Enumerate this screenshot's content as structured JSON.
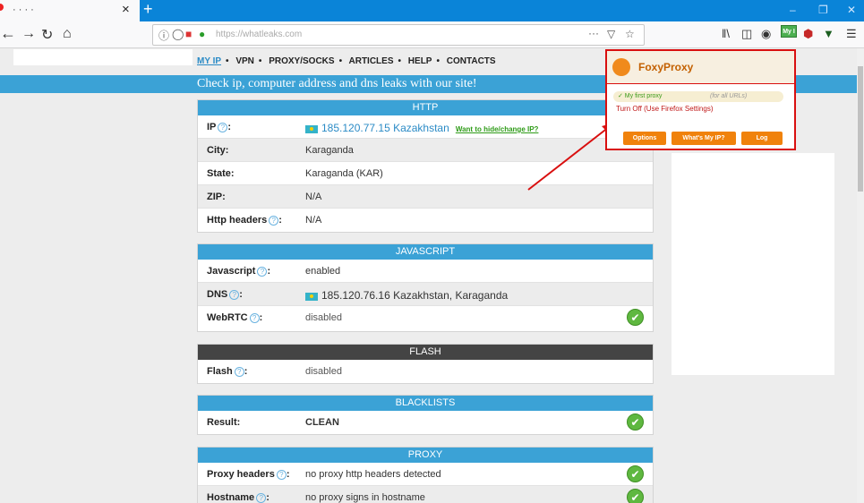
{
  "browser": {
    "tab_title": "· · · ·",
    "tab_close": "×",
    "newtab": "+",
    "url": "https://whatleaks.com",
    "page_actions": "···",
    "myip_badge": "My I"
  },
  "topnav": [
    "MY IP",
    "VPN",
    "PROXY/SOCKS",
    "ARTICLES",
    "HELP",
    "CONTACTS"
  ],
  "banner": "Check ip, computer address and dns leaks with our site!",
  "sections": {
    "http": {
      "title": "HTTP",
      "ip_label": "IP",
      "ip_value": "185.120.77.15 Kazakhstan",
      "ip_link": "Want to hide/change IP?",
      "city_label": "City:",
      "city_value": "Karaganda",
      "state_label": "State:",
      "state_value": "Karaganda (KAR)",
      "zip_label": "ZIP:",
      "zip_value": "N/A",
      "headers_label": "Http headers",
      "headers_value": "N/A"
    },
    "javascript": {
      "title": "JAVASCRIPT",
      "js_label": "Javascript",
      "js_value": "enabled",
      "dns_label": "DNS",
      "dns_value": "185.120.76.16 Kazakhstan, Karaganda",
      "webrtc_label": "WebRTC",
      "webrtc_value": "disabled"
    },
    "flash": {
      "title": "FLASH",
      "flash_label": "Flash",
      "flash_value": "disabled"
    },
    "blacklists": {
      "title": "BLACKLISTS",
      "result_label": "Result:",
      "result_value": "CLEAN"
    },
    "proxy": {
      "title": "PROXY",
      "headers_label": "Proxy headers",
      "headers_value": "no proxy http headers detected",
      "hostname_label": "Hostname",
      "hostname_value": "no proxy signs in hostname"
    }
  },
  "foxyproxy": {
    "title": "FoxyProxy",
    "proxy_name": "✓ My first proxy",
    "proxy_scope": "(for all URLs)",
    "turn_off": "Turn Off (Use Firefox Settings)",
    "btn_options": "Options",
    "btn_whats_my_ip": "What's My IP?",
    "btn_log": "Log"
  },
  "colors": {
    "accent_blue": "#3ba2d6",
    "highlight_red": "#d90f0f",
    "button_orange": "#f0820c",
    "clean_green": "#2e9b17"
  }
}
